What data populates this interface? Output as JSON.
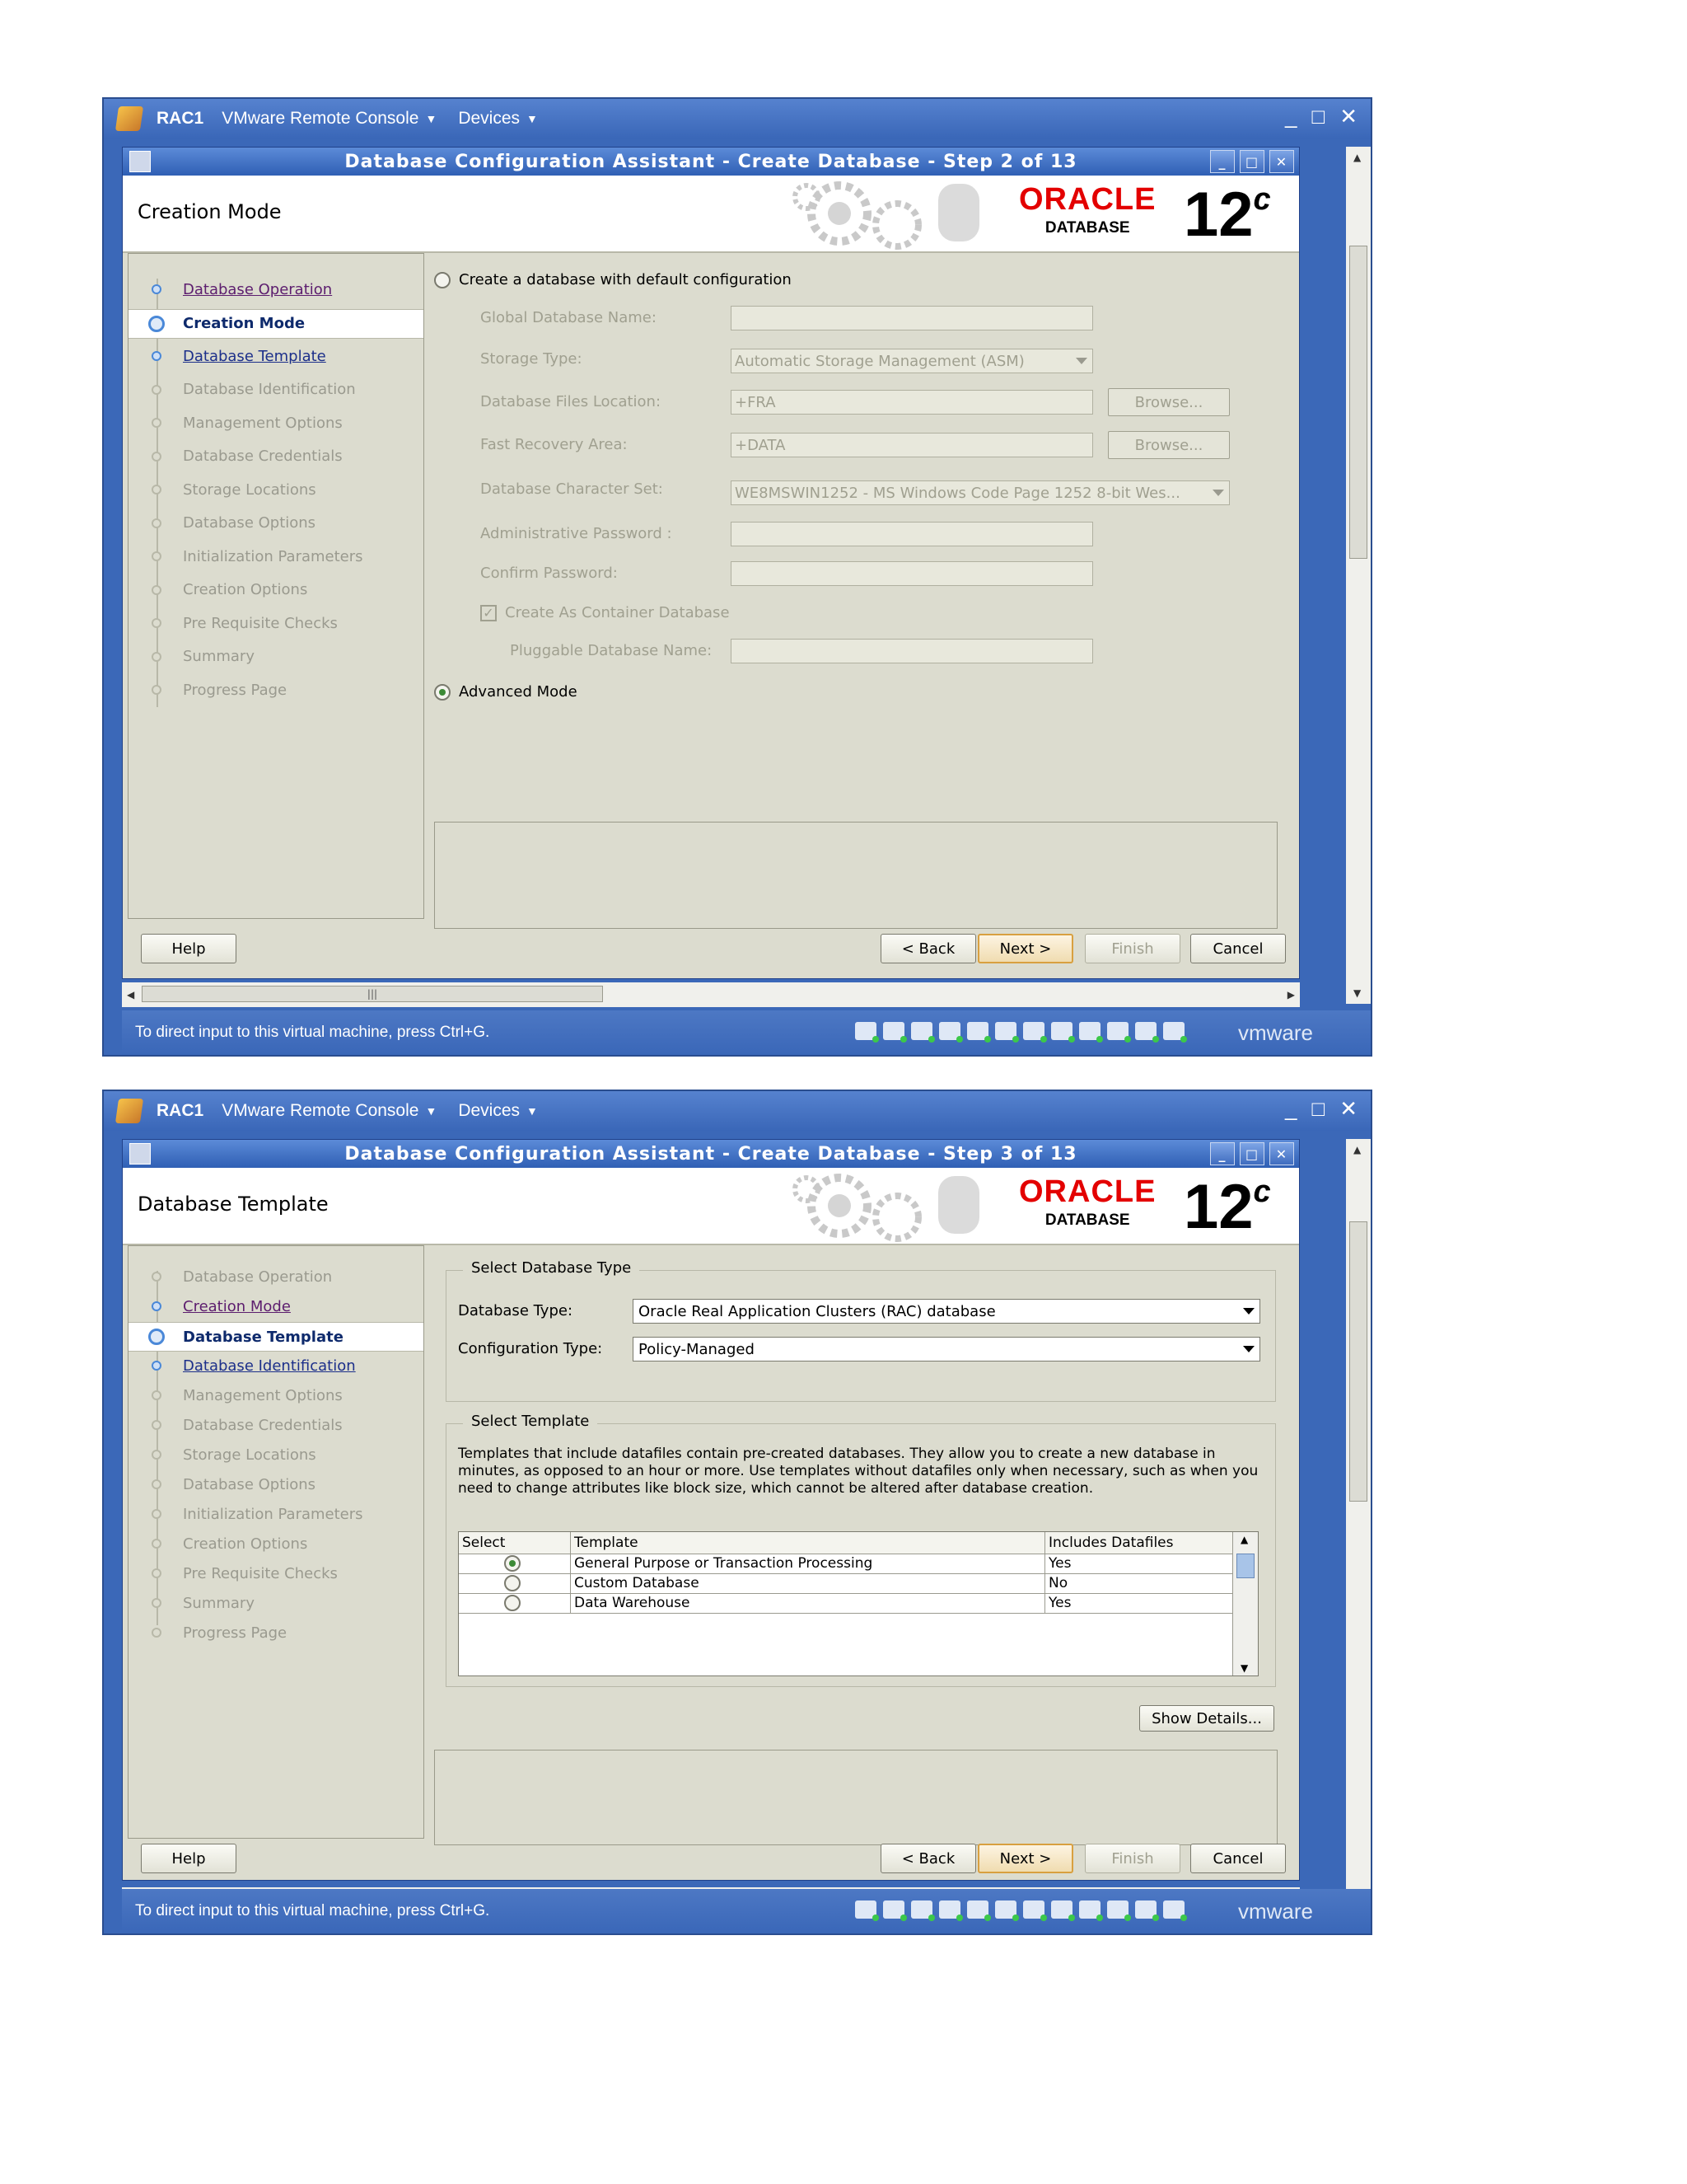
{
  "vm_titlebar": {
    "name": "RAC1",
    "console_label": "VMware Remote Console",
    "devices_label": "Devices"
  },
  "window_controls": {
    "minimize": "_",
    "maximize": "□",
    "close": "✕"
  },
  "status": {
    "text": "To direct input to this virtual machine, press Ctrl+G.",
    "brand": "vmware"
  },
  "oracle": {
    "wordmark": "ORACLE",
    "product": "DATABASE",
    "version": "12",
    "version_suffix": "c"
  },
  "buttons": {
    "help": "Help",
    "back": "< Back",
    "next": "Next >",
    "finish": "Finish",
    "cancel": "Cancel"
  },
  "step2": {
    "dialog_title": "Database Configuration Assistant - Create Database - Step 2 of 13",
    "page_title": "Creation Mode",
    "nav": [
      {
        "label": "Database Operation",
        "state": "visited"
      },
      {
        "label": "Creation Mode",
        "state": "current"
      },
      {
        "label": "Database Template",
        "state": "link"
      },
      {
        "label": "Database Identification",
        "state": "disabled"
      },
      {
        "label": "Management Options",
        "state": "disabled"
      },
      {
        "label": "Database Credentials",
        "state": "disabled"
      },
      {
        "label": "Storage Locations",
        "state": "disabled"
      },
      {
        "label": "Database Options",
        "state": "disabled"
      },
      {
        "label": "Initialization Parameters",
        "state": "disabled"
      },
      {
        "label": "Creation Options",
        "state": "disabled"
      },
      {
        "label": "Pre Requisite Checks",
        "state": "disabled"
      },
      {
        "label": "Summary",
        "state": "disabled"
      },
      {
        "label": "Progress Page",
        "state": "disabled"
      }
    ],
    "default_config_label": "Create a database with default configuration",
    "fields": {
      "global_db_name_label": "Global Database Name:",
      "global_db_name_value": "",
      "storage_type_label": "Storage Type:",
      "storage_type_value": "Automatic Storage Management (ASM)",
      "db_files_location_label": "Database Files Location:",
      "db_files_location_value": "+FRA",
      "fast_recovery_area_label": "Fast Recovery Area:",
      "fast_recovery_area_value": "+DATA",
      "browse_label": "Browse...",
      "charset_label": "Database Character Set:",
      "charset_value": "WE8MSWIN1252 - MS Windows Code Page 1252 8-bit Wes...",
      "admin_password_label": "Administrative Password :",
      "confirm_password_label": "Confirm Password:",
      "container_db_label": "Create As Container Database",
      "pluggable_db_name_label": "Pluggable Database Name:"
    },
    "advanced_mode_label": "Advanced Mode"
  },
  "step3": {
    "dialog_title": "Database Configuration Assistant - Create Database - Step 3 of 13",
    "page_title": "Database Template",
    "nav": [
      {
        "label": "Database Operation",
        "state": "disabled"
      },
      {
        "label": "Creation Mode",
        "state": "visited"
      },
      {
        "label": "Database Template",
        "state": "current"
      },
      {
        "label": "Database Identification",
        "state": "link"
      },
      {
        "label": "Management Options",
        "state": "disabled"
      },
      {
        "label": "Database Credentials",
        "state": "disabled"
      },
      {
        "label": "Storage Locations",
        "state": "disabled"
      },
      {
        "label": "Database Options",
        "state": "disabled"
      },
      {
        "label": "Initialization Parameters",
        "state": "disabled"
      },
      {
        "label": "Creation Options",
        "state": "disabled"
      },
      {
        "label": "Pre Requisite Checks",
        "state": "disabled"
      },
      {
        "label": "Summary",
        "state": "disabled"
      },
      {
        "label": "Progress Page",
        "state": "disabled"
      }
    ],
    "db_type_group": "Select Database Type",
    "db_type_label": "Database Type:",
    "db_type_value": "Oracle Real Application Clusters (RAC) database",
    "config_type_label": "Configuration Type:",
    "config_type_value": "Policy-Managed",
    "template_group": "Select Template",
    "description": "Templates that include datafiles contain pre-created databases. They allow you to create a new database in minutes, as opposed to an hour or more. Use templates without datafiles only when necessary, such as when you need to change attributes like block size, which cannot be altered after database creation.",
    "table": {
      "headers": [
        "Select",
        "Template",
        "Includes Datafiles"
      ],
      "rows": [
        {
          "selected": true,
          "template": "General Purpose or Transaction Processing",
          "datafiles": "Yes"
        },
        {
          "selected": false,
          "template": "Custom Database",
          "datafiles": "No"
        },
        {
          "selected": false,
          "template": "Data Warehouse",
          "datafiles": "Yes"
        }
      ]
    },
    "show_details_label": "Show Details..."
  },
  "colors": {
    "vm_frame": "#3b68b8",
    "dialog_bg": "#dcdccf",
    "oracle_red": "#e30000",
    "next_border": "#d8a040"
  }
}
